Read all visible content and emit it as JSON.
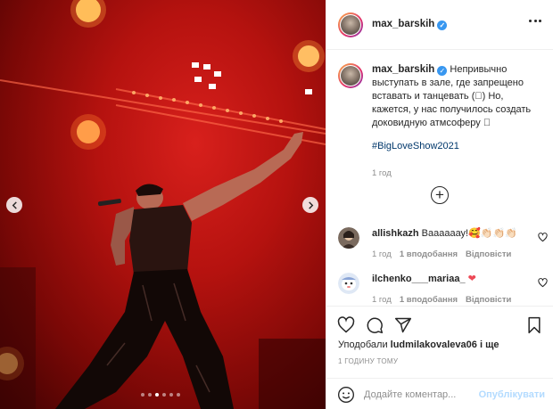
{
  "post": {
    "username": "max_barskih",
    "verified_glyph": "✓",
    "more_icon": "more-horizontal-icon",
    "caption_text": "Непривычно выступать в зале, где запрещено вставать и танцевать (􀀀) Но, кажется, у нас получилось создать доковидную атмсоферу 􀀀",
    "hashtag": "#BigLoveShow2021",
    "caption_time": "1 год"
  },
  "load_more_label": "+",
  "comments": [
    {
      "username": "allishkazh",
      "text": "Ваааааау!🥰👏🏻👏🏻👏🏻",
      "time": "1 год",
      "likes": "1 вподобання",
      "reply": "Відповісти"
    },
    {
      "username": "ilchenko___mariaa_",
      "text": "❤",
      "time": "1 год",
      "likes": "1 вподобання",
      "reply": "Відповісти"
    }
  ],
  "actions": {
    "icons": [
      "heart-icon",
      "comment-icon",
      "share-icon",
      "bookmark-icon"
    ],
    "liked_by_prefix": "Уподобали",
    "liked_by_user": "ludmilakovaleva06",
    "liked_by_suffix": "і ще",
    "timestamp": "1 ГОДИНУ ТОМУ"
  },
  "comment_box": {
    "placeholder": "Додайте коментар...",
    "post_label": "Опублікувати"
  },
  "carousel": {
    "slide_count": 6,
    "active_index": 2
  },
  "colors": {
    "link": "#00376b",
    "verified": "#3897f0",
    "post_disabled": "#b3dbff",
    "meta": "#8e8e8e",
    "heart_red": "#ed4956"
  }
}
